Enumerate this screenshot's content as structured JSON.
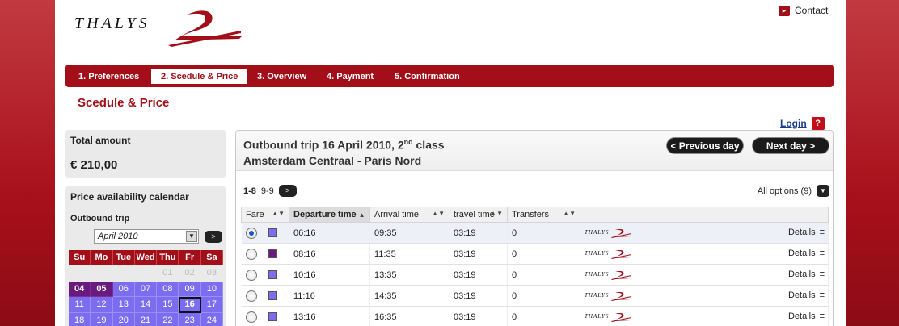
{
  "brand": {
    "logo_text": "THALYS",
    "accent": "#a20f18"
  },
  "header": {
    "contact_label": "Contact",
    "contact_icon": "arrow-right-icon"
  },
  "steps": [
    {
      "label": "1. Preferences",
      "active": false
    },
    {
      "label": "2. Scedule & Price",
      "active": true
    },
    {
      "label": "3. Overview",
      "active": false
    },
    {
      "label": "4. Payment",
      "active": false
    },
    {
      "label": "5. Confirmation",
      "active": false
    }
  ],
  "page_title": "Scedule & Price",
  "login": {
    "label": "Login",
    "help": "?"
  },
  "total": {
    "title": "Total amount",
    "value": "€ 210,00"
  },
  "calendar": {
    "title": "Price availability calendar",
    "subtitle": "Outbound trip",
    "month": "April 2010",
    "next": ">",
    "weekdays": [
      "Su",
      "Mo",
      "Tue",
      "Wed",
      "Thu",
      "Fr",
      "Sa"
    ],
    "days": [
      {
        "d": "",
        "t": "empty"
      },
      {
        "d": "",
        "t": "empty"
      },
      {
        "d": "",
        "t": "empty"
      },
      {
        "d": "",
        "t": "empty"
      },
      {
        "d": "01",
        "t": "empty"
      },
      {
        "d": "02",
        "t": "empty"
      },
      {
        "d": "03",
        "t": "empty"
      },
      {
        "d": "04",
        "t": "past"
      },
      {
        "d": "05",
        "t": "past"
      },
      {
        "d": "06",
        "t": "open"
      },
      {
        "d": "07",
        "t": "open"
      },
      {
        "d": "08",
        "t": "open"
      },
      {
        "d": "09",
        "t": "open"
      },
      {
        "d": "10",
        "t": "open"
      },
      {
        "d": "11",
        "t": "open"
      },
      {
        "d": "12",
        "t": "open"
      },
      {
        "d": "13",
        "t": "open"
      },
      {
        "d": "14",
        "t": "open"
      },
      {
        "d": "15",
        "t": "open"
      },
      {
        "d": "16",
        "t": "selected"
      },
      {
        "d": "17",
        "t": "open"
      },
      {
        "d": "18",
        "t": "open"
      },
      {
        "d": "19",
        "t": "open"
      },
      {
        "d": "20",
        "t": "open"
      },
      {
        "d": "21",
        "t": "open"
      },
      {
        "d": "22",
        "t": "open"
      },
      {
        "d": "23",
        "t": "open"
      },
      {
        "d": "24",
        "t": "open"
      }
    ]
  },
  "trip": {
    "title": "Outbound trip 16 April 2010, 2",
    "title_sup": "nd",
    "title_tail": " class",
    "route": "Amsterdam Centraal - Paris Nord",
    "prev_day": "< Previous day",
    "next_day": "Next day >",
    "pager": {
      "current": "1-8",
      "other": "9-9",
      "next": ">"
    },
    "all_options": "All options (9)",
    "columns": [
      "Fare",
      "Departure time",
      "Arrival time",
      "travel time",
      "Transfers"
    ],
    "details_label": "Details",
    "rows": [
      {
        "departure": "06:16",
        "arrival": "09:35",
        "travel": "03:19",
        "transfers": "0",
        "fare_color": "#7b6cf0",
        "selected": true
      },
      {
        "departure": "08:16",
        "arrival": "11:35",
        "travel": "03:19",
        "transfers": "0",
        "fare_color": "#6a1a7e",
        "selected": false
      },
      {
        "departure": "10:16",
        "arrival": "13:35",
        "travel": "03:19",
        "transfers": "0",
        "fare_color": "#7b6cf0",
        "selected": false
      },
      {
        "departure": "11:16",
        "arrival": "14:35",
        "travel": "03:19",
        "transfers": "0",
        "fare_color": "#7b6cf0",
        "selected": false
      },
      {
        "departure": "13:16",
        "arrival": "16:35",
        "travel": "03:19",
        "transfers": "0",
        "fare_color": "#7b6cf0",
        "selected": false
      }
    ]
  }
}
